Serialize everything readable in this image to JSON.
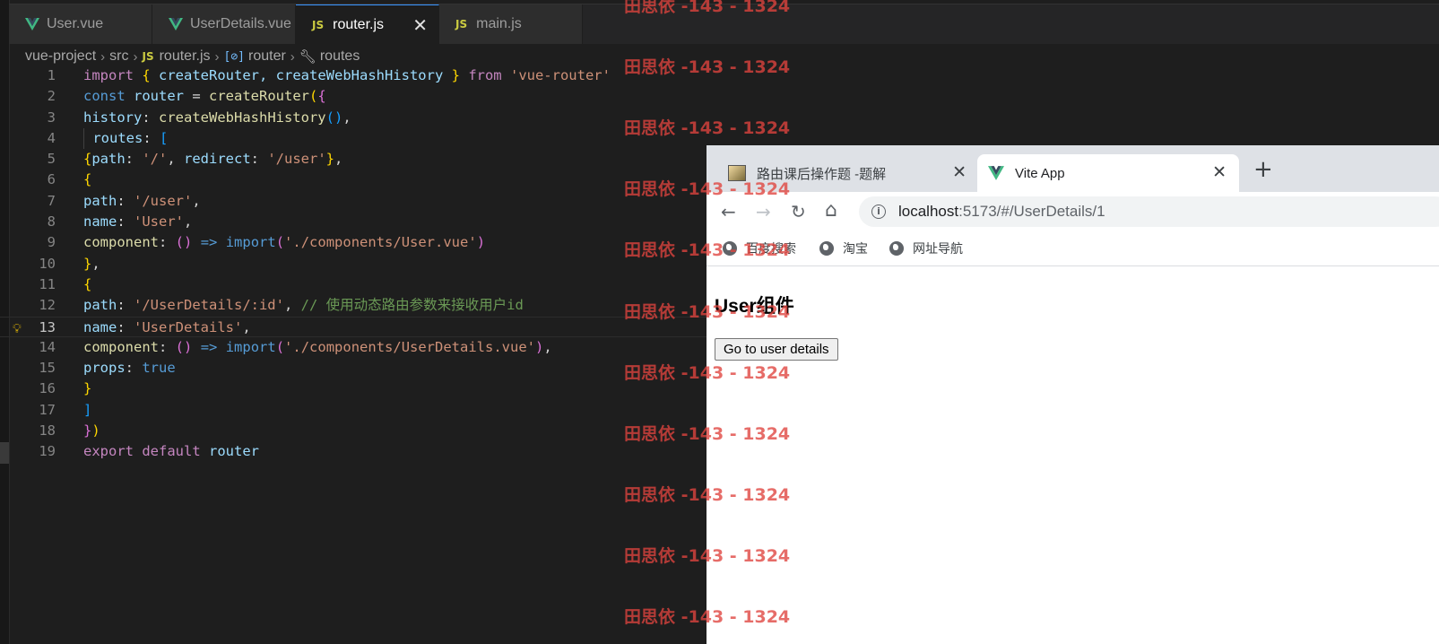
{
  "editor": {
    "tabs": [
      {
        "label": "User.vue",
        "icon": "vue-icon"
      },
      {
        "label": "UserDetails.vue",
        "icon": "vue-icon"
      },
      {
        "label": "router.js",
        "icon": "js-icon",
        "active": true
      },
      {
        "label": "main.js",
        "icon": "js-icon"
      }
    ],
    "js_icon_text": "JS",
    "close_glyph": "✕",
    "breadcrumb": [
      "vue-project",
      "src",
      "router.js",
      "router",
      "routes"
    ],
    "line_numbers": [
      "1",
      "2",
      "3",
      "4",
      "5",
      "6",
      "7",
      "8",
      "9",
      "10",
      "11",
      "12",
      "13",
      "14",
      "15",
      "16",
      "17",
      "18",
      "19"
    ],
    "current_line": 13,
    "code": {
      "l1": [
        "import",
        " ",
        "{",
        " createRouter, createWebHashHistory ",
        "}",
        " from ",
        "'vue-router'"
      ],
      "l2": [
        "const",
        " router ",
        "=",
        " createRouter",
        "(",
        "{"
      ],
      "l3": [
        "history",
        ": ",
        "createWebHashHistory",
        "()",
        ","
      ],
      "l4": [
        " routes",
        ": ",
        "["
      ],
      "l5": [
        "{",
        "path",
        ": ",
        "'/'",
        ", ",
        "redirect",
        ": ",
        "'/user'",
        "}",
        ","
      ],
      "l6": [
        "{"
      ],
      "l7": [
        "path",
        ": ",
        "'/user'",
        ","
      ],
      "l8": [
        "name",
        ": ",
        "'User'",
        ","
      ],
      "l9": [
        "component",
        ": ",
        "()",
        " ",
        "=>",
        " ",
        "import",
        "(",
        "'./components/User.vue'",
        ")"
      ],
      "l10": [
        "}",
        ","
      ],
      "l11": [
        "{"
      ],
      "l12": [
        "path",
        ": ",
        "'/UserDetails/:id'",
        ", ",
        "// 使用动态路由参数来接收用户id"
      ],
      "l13": [
        "name",
        ": ",
        "'UserDetails'",
        ","
      ],
      "l14": [
        "component",
        ": ",
        "()",
        " ",
        "=>",
        " ",
        "import",
        "(",
        "'./components/UserDetails.vue'",
        ")",
        ","
      ],
      "l15": [
        "props",
        ": ",
        "true"
      ],
      "l16": [
        "}"
      ],
      "l17": [
        "]"
      ],
      "l18": [
        "}",
        ")"
      ],
      "l19": [
        "export",
        " ",
        "default",
        " ",
        "router"
      ]
    }
  },
  "browser": {
    "tabs": [
      {
        "title": "路由课后操作题 -题解"
      },
      {
        "title": "Vite App",
        "active": true
      }
    ],
    "close_glyph": "✕",
    "new_tab_glyph": "+",
    "nav": {
      "back": "←",
      "forward": "→",
      "reload": "↻",
      "home": "⌂"
    },
    "info_glyph": "i",
    "url_host": "localhost",
    "url_path": ":5173/#/UserDetails/1",
    "bookmarks": [
      "百度搜索",
      "淘宝",
      "网址导航"
    ],
    "page": {
      "heading": "User组件",
      "button_label": "Go to user details"
    }
  },
  "watermark": {
    "text": "田思依 -143 - 1324",
    "color": "#e0443e",
    "count": 11
  }
}
